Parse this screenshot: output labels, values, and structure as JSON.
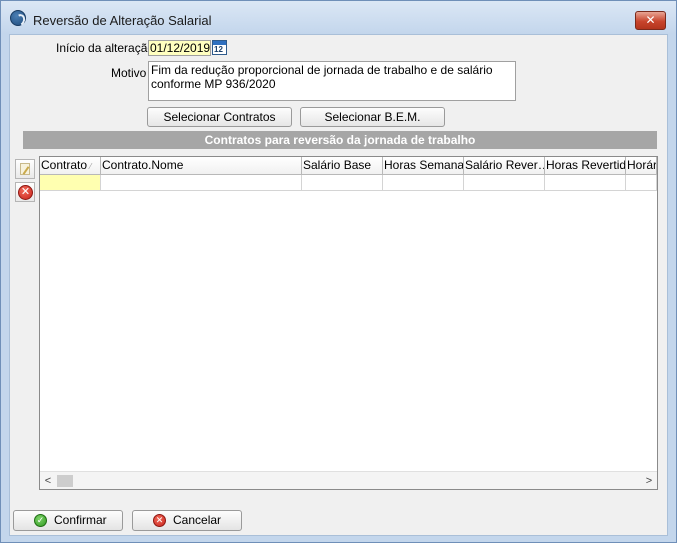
{
  "window": {
    "title": "Reversão de Alteração Salarial",
    "close_glyph": "✕"
  },
  "form": {
    "inicio_label": "Início da alteração",
    "inicio_value": "01/12/2019",
    "calendar_day": "12",
    "motivo_label": "Motivo",
    "motivo_value": "Fim da redução proporcional de jornada de trabalho e de salário conforme MP 936/2020"
  },
  "buttons": {
    "selecionar_contratos": "Selecionar Contratos",
    "selecionar_bem": "Selecionar B.E.M.",
    "confirmar": "Confirmar",
    "cancelar": "Cancelar"
  },
  "section": {
    "title": "Contratos para reversão da jornada de trabalho"
  },
  "grid": {
    "columns": [
      "Contrato",
      "Contrato.Nome",
      "Salário Base",
      "Horas Semanais",
      "Salário Rever…",
      "Horas Revertido",
      "Horár"
    ],
    "sort_glyph": "⁄",
    "rows": [
      [
        "",
        "",
        "",
        "",
        "",
        "",
        ""
      ]
    ]
  },
  "icons": {
    "app": "app-logo-icon",
    "calendar": "calendar-icon",
    "edit": "edit-icon",
    "delete": "delete-icon",
    "ok": "check-icon",
    "cancel": "cancel-icon",
    "delete_glyph": "✕",
    "ok_glyph": "✓",
    "cancel_glyph": "✕",
    "scroll_left": "<",
    "scroll_right": ">"
  },
  "colors": {
    "window_frame": "#c3d6ec",
    "section_header": "#a6a6a6",
    "selected_cell": "#ffffb0",
    "date_field": "#ffffc0",
    "close_button": "#c8452d"
  }
}
